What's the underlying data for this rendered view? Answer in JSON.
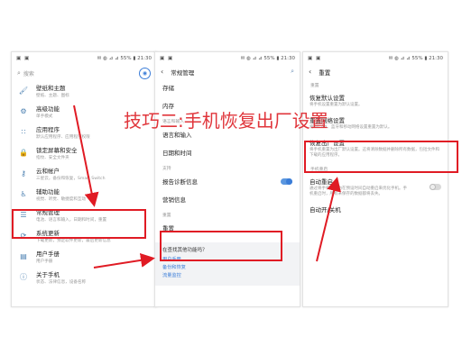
{
  "overlay_title": "技巧二:手机恢复出厂设置",
  "status": {
    "left": "▣ ▣",
    "right": "✉ ◍ ⊿ ⊿ 55% ▮ 21:30",
    "right2": "✉ ◍ ⊿ ⊿ 55% ▮ 21:30",
    "right3": "✉ ◍ ⊿ ⊿ 55% ▮ 21:30"
  },
  "screen1": {
    "search_placeholder": "搜索",
    "items": [
      {
        "icon": "paint-icon",
        "glyph": "🖌",
        "title": "壁纸和主题",
        "sub": "壁纸、主题、图标"
      },
      {
        "icon": "gear-icon",
        "glyph": "⚙",
        "title": "高级功能",
        "sub": "单手模式"
      },
      {
        "icon": "apps-icon",
        "glyph": "∷",
        "title": "应用程序",
        "sub": "默认应用程序、应用程序权限"
      },
      {
        "icon": "lock-icon",
        "glyph": "🔒",
        "title": "锁定屏幕和安全",
        "sub": "指纹、安全文件夹"
      },
      {
        "icon": "key-icon",
        "glyph": "⚷",
        "title": "云和帐户",
        "sub": "三星云，备份和恢复，Smart Switch"
      },
      {
        "icon": "accessibility-icon",
        "glyph": "♿",
        "title": "辅助功能",
        "sub": "视觉、听觉、敏捷度和互动"
      },
      {
        "icon": "sliders-icon",
        "glyph": "☰",
        "title": "常规管理",
        "sub": "电池、语言和输入，日期和时间，重置"
      },
      {
        "icon": "update-icon",
        "glyph": "⟳",
        "title": "系统更新",
        "sub": "下载更新，预定软件更新，最后更新信息"
      },
      {
        "icon": "manual-icon",
        "glyph": "▤",
        "title": "用户手册",
        "sub": "用户手册"
      },
      {
        "icon": "info-icon",
        "glyph": "ⓘ",
        "title": "关于手机",
        "sub": "状态、法律信息，设备名称"
      }
    ]
  },
  "screen2": {
    "title": "常规管理",
    "rows": [
      {
        "label": "存储"
      },
      {
        "label": "内存"
      },
      {
        "section": "语言和输入"
      },
      {
        "label": "语言和输入"
      },
      {
        "label": "日期和时间"
      },
      {
        "section": "支持"
      },
      {
        "label": "报告诊断信息",
        "toggle": "on"
      },
      {
        "label": "营销信息"
      },
      {
        "section": "重置"
      },
      {
        "label": "重置"
      }
    ],
    "help_question": "在查找其他功能吗？",
    "help_links": [
      "用户手册",
      "备份和恢复",
      "流量监控"
    ]
  },
  "screen3": {
    "title": "重置",
    "section1": "重置",
    "items": [
      {
        "title": "恢复默认设置",
        "sub": "将手机设置重置为默认设置。"
      },
      {
        "title": "重置网络设置",
        "sub": "将 WLAN、蓝牙和移动网络设置重置为默认。"
      },
      {
        "title": "恢复出厂设置",
        "sub": "将手机重置为出厂默认设置。这将清除数据并删除所有数据，包括文件和下载的应用程序。"
      }
    ],
    "section2": "手机重启",
    "auto_restart_title": "自动重启",
    "auto_restart_sub": "通过将手机设置为在预设时间自动重启来优化手机。手机重启时，所有未保存的数据都将丢失。",
    "auto_power_title": "自动开/关机"
  },
  "colors": {
    "annotation_red": "#e01b24",
    "accent_blue": "#3b7dd8"
  }
}
